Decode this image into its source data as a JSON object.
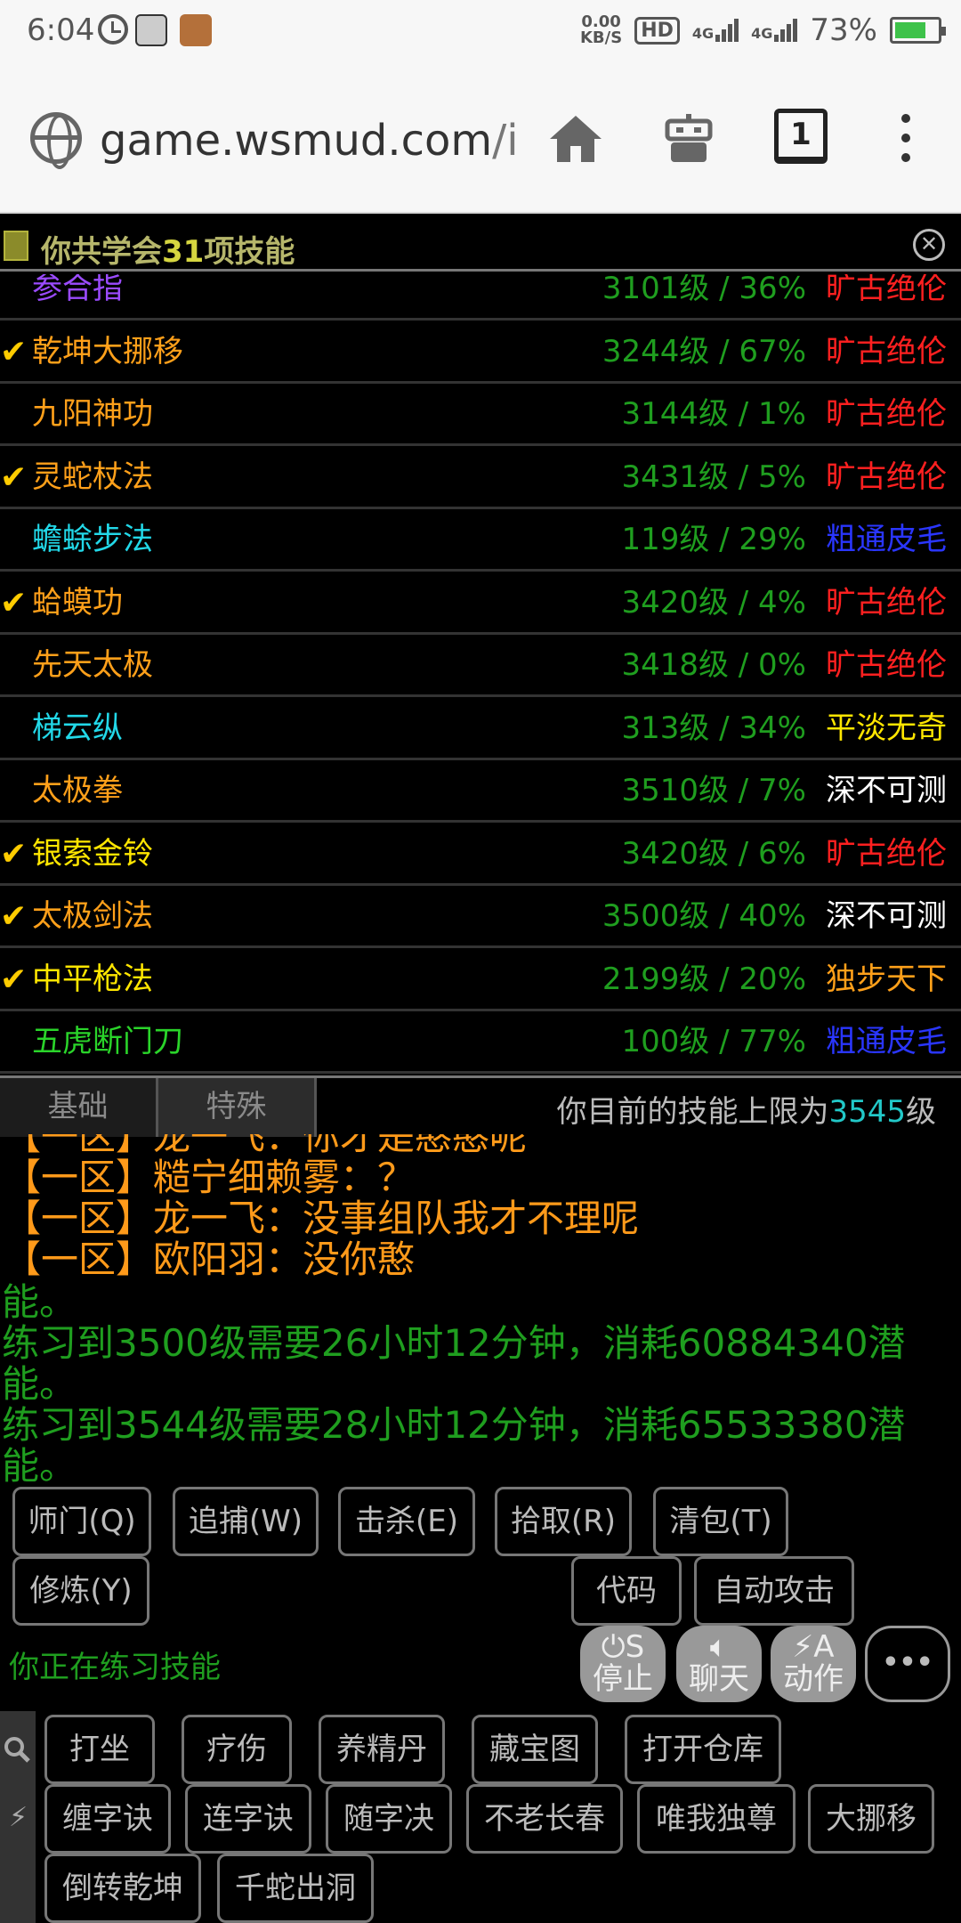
{
  "status_bar": {
    "time": "6:04",
    "net_speed": "0.00",
    "net_unit": "KB/S",
    "hd": "HD",
    "sig1": "4G",
    "sig2": "4G",
    "battery": "73%",
    "battery_level": 0.73
  },
  "browser": {
    "url_host": "game.wsmud.com",
    "url_path": "/inc",
    "tab_count": "1"
  },
  "panel": {
    "title_prefix": "你共学会",
    "title_count": "31",
    "title_suffix": "项技能"
  },
  "skills": [
    {
      "check": "",
      "name": "参合指",
      "name_color": "#9b4bff",
      "stat": "3101级 / 36%",
      "rank": "旷古绝伦",
      "rank_color": "#ff2020"
    },
    {
      "check": "✔",
      "name": "乾坤大挪移",
      "name_color": "#ffa01a",
      "stat": "3244级 / 67%",
      "rank": "旷古绝伦",
      "rank_color": "#ff2020"
    },
    {
      "check": "",
      "name": "九阳神功",
      "name_color": "#ffa01a",
      "stat": "3144级 / 1%",
      "rank": "旷古绝伦",
      "rank_color": "#ff2020"
    },
    {
      "check": "✔",
      "name": "灵蛇杖法",
      "name_color": "#ffa01a",
      "stat": "3431级 / 5%",
      "rank": "旷古绝伦",
      "rank_color": "#ff2020"
    },
    {
      "check": "",
      "name": "蟾蜍步法",
      "name_color": "#22d8e8",
      "stat": "119级 / 29%",
      "rank": "粗通皮毛",
      "rank_color": "#2a36ff"
    },
    {
      "check": "✔",
      "name": "蛤蟆功",
      "name_color": "#ffa01a",
      "stat": "3420级 / 4%",
      "rank": "旷古绝伦",
      "rank_color": "#ff2020"
    },
    {
      "check": "",
      "name": "先天太极",
      "name_color": "#ffa01a",
      "stat": "3418级 / 0%",
      "rank": "旷古绝伦",
      "rank_color": "#ff2020"
    },
    {
      "check": "",
      "name": "梯云纵",
      "name_color": "#22d8e8",
      "stat": "313级 / 34%",
      "rank": "平淡无奇",
      "rank_color": "#ffe600"
    },
    {
      "check": "",
      "name": "太极拳",
      "name_color": "#ffa01a",
      "stat": "3510级 / 7%",
      "rank": "深不可测",
      "rank_color": "#ffffff"
    },
    {
      "check": "✔",
      "name": "银索金铃",
      "name_color": "#ffe600",
      "stat": "3420级 / 6%",
      "rank": "旷古绝伦",
      "rank_color": "#ff2020"
    },
    {
      "check": "✔",
      "name": "太极剑法",
      "name_color": "#ffa01a",
      "stat": "3500级 / 40%",
      "rank": "深不可测",
      "rank_color": "#ffffff"
    },
    {
      "check": "✔",
      "name": "中平枪法",
      "name_color": "#ffe600",
      "stat": "2199级 / 20%",
      "rank": "独步天下",
      "rank_color": "#ffa01a"
    },
    {
      "check": "",
      "name": "五虎断门刀",
      "name_color": "#2ad42a",
      "stat": "100级 / 77%",
      "rank": "粗通皮毛",
      "rank_color": "#2a36ff"
    }
  ],
  "tabs": {
    "basic": "基础",
    "special": "特殊"
  },
  "skill_limit": {
    "prefix": "你目前的技能上限为",
    "value": "3545",
    "suffix": "级"
  },
  "chat": [
    "【一区】龙一飞：你才是憨憨呢",
    "【一区】糙宁细赖雾：？",
    "【一区】龙一飞：没事组队我才不理呢",
    "【一区】欧阳羽：没你憨"
  ],
  "system_log": [
    "能。",
    "练习到3500级需要26小时12分钟，消耗60884340潜能。",
    "练习到3544级需要28小时12分钟，消耗65533380潜能。"
  ],
  "buttons_row1": [
    "师门(Q)",
    "追捕(W)",
    "击杀(E)",
    "拾取(R)",
    "清包(T)"
  ],
  "buttons_row2": {
    "cultivate": "修炼(Y)",
    "code": "代码",
    "auto_attack": "自动攻击"
  },
  "practice_status": "你正在练习技能",
  "round_buttons": {
    "stop_key": "S",
    "stop_label": "停止",
    "chat_label": "聊天",
    "action_key": "A",
    "action_label": "动作",
    "more": "•••"
  },
  "action_buttons_row1": [
    "打坐",
    "疗伤",
    "养精丹",
    "藏宝图",
    "打开仓库"
  ],
  "action_buttons_row2": [
    "缠字诀",
    "连字诀",
    "随字决",
    "不老长春",
    "唯我独尊",
    "大挪移"
  ],
  "action_buttons_row3": [
    "倒转乾坤",
    "千蛇出洞"
  ]
}
